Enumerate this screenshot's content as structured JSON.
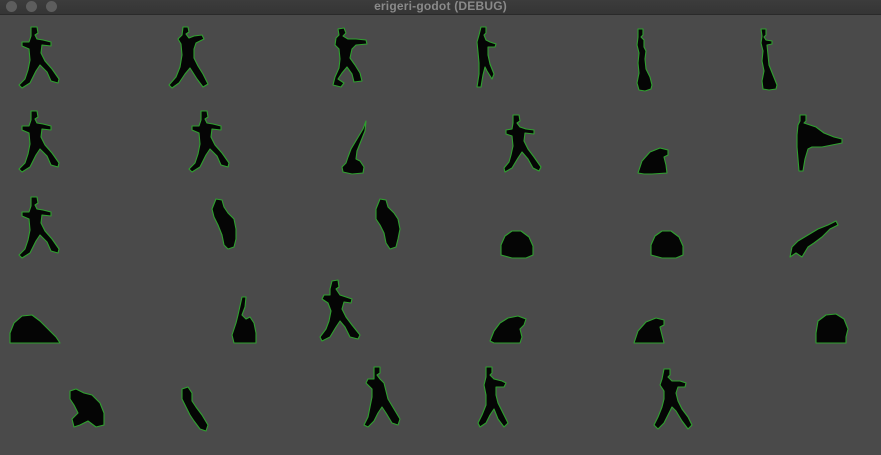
{
  "window": {
    "title": "erigeri-godot (DEBUG)"
  },
  "icons": {
    "close": "close-traffic-light-icon",
    "minimize": "minimize-traffic-light-icon",
    "maximize": "maximize-traffic-light-icon"
  },
  "colors": {
    "background": "#4a4a4a",
    "sprite_fill": "#050505",
    "sprite_outline": "#2fa02f"
  }
}
